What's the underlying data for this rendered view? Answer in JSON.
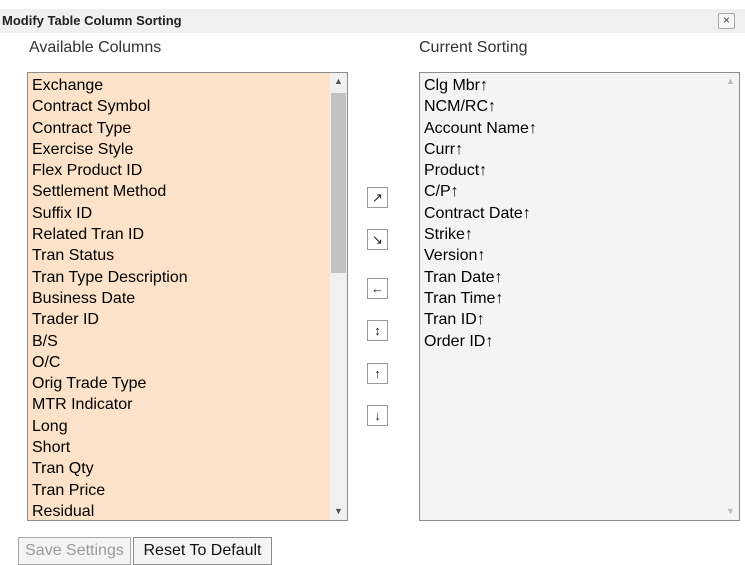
{
  "dialog": {
    "title": "Modify Table Column Sorting",
    "close_icon": "×"
  },
  "available": {
    "label": "Available Columns",
    "items": [
      "Exchange",
      "Contract Symbol",
      "Contract Type",
      "Exercise Style",
      "Flex Product ID",
      "Settlement Method",
      "Suffix ID",
      "Related Tran ID",
      "Tran Status",
      "Tran Type Description",
      "Business Date",
      "Trader ID",
      "B/S",
      "O/C",
      "Orig Trade Type",
      "MTR Indicator",
      "Long",
      "Short",
      "Tran Qty",
      "Tran Price",
      "Residual"
    ],
    "background_color": "#fbe2c8"
  },
  "current": {
    "label": "Current Sorting",
    "items": [
      "Clg Mbr↑",
      "NCM/RC↑",
      "Account Name↑",
      "Curr↑",
      "Product↑",
      "C/P↑",
      "Contract Date↑",
      "Strike↑",
      "Version↑",
      "Tran Date↑",
      "Tran Time↑",
      "Tran ID↑",
      "Order ID↑"
    ]
  },
  "move_buttons": [
    {
      "name": "move-up-right-icon",
      "glyph": "↗"
    },
    {
      "name": "move-down-right-icon",
      "glyph": "↘"
    },
    {
      "name": "move-left-icon",
      "glyph": "←"
    },
    {
      "name": "toggle-direction-icon",
      "glyph": "↕"
    },
    {
      "name": "move-up-icon",
      "glyph": "↑"
    },
    {
      "name": "move-down-icon",
      "glyph": "↓"
    }
  ],
  "footer": {
    "save_label": "Save Settings",
    "reset_label": "Reset To Default"
  },
  "scroll": {
    "up_glyph": "▲",
    "down_glyph": "▼"
  }
}
